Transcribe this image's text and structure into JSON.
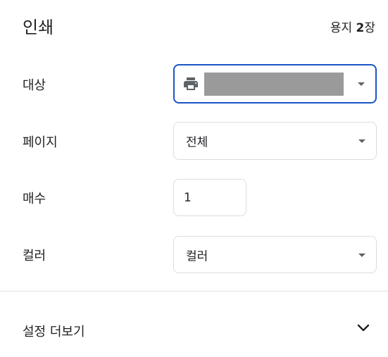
{
  "header": {
    "title": "인쇄",
    "sheets_prefix": "용지 ",
    "sheets_count": "2",
    "sheets_suffix": "장"
  },
  "destination": {
    "label": "대상",
    "icon": "printer-icon",
    "value_redacted": true
  },
  "pages": {
    "label": "페이지",
    "value": "전체"
  },
  "copies": {
    "label": "매수",
    "value": "1"
  },
  "color": {
    "label": "컬러",
    "value": "컬러"
  },
  "more_settings": {
    "label": "설정 더보기",
    "icon": "chevron-down-icon"
  },
  "colors": {
    "focus_border": "#1a56c6",
    "field_border": "#dadce0",
    "text": "#202124",
    "icon": "#5f6368"
  }
}
